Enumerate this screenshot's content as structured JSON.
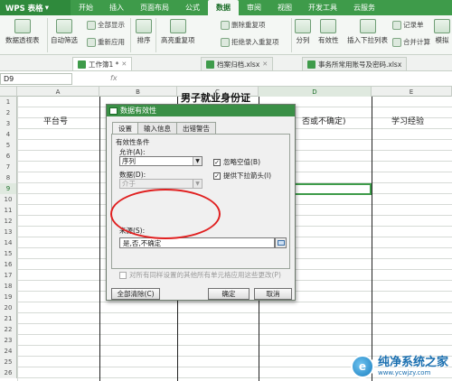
{
  "app": {
    "logo": "WPS 表格",
    "logo_arrow": "▾"
  },
  "menu": [
    "开始",
    "插入",
    "页面布局",
    "公式",
    "数据",
    "审阅",
    "视图",
    "开发工具",
    "云服务"
  ],
  "ribbon": {
    "pivot": "数据透视表",
    "autofilter": "自动筛选",
    "show_all": "全部显示",
    "reapply": "重新应用",
    "sort": "排序",
    "highlight_dup": "高亮重复项",
    "delete_dup": "删除重复项",
    "reject_dup": "拒绝录入重复项",
    "split": "分列",
    "validity": "有效性",
    "insert_dropdown": "插入下拉列表",
    "consolidate": "合并计算",
    "record": "记录单",
    "simulate": "模拟"
  },
  "doctabs": [
    {
      "label": "工作簿1 *",
      "active": true
    },
    {
      "label": "档案归档.xlsx",
      "active": false
    },
    {
      "label": "事务所常用账号及密码.xlsx",
      "active": false
    }
  ],
  "formula": {
    "cell": "D9",
    "fx": "fx"
  },
  "columns": [
    "A",
    "B",
    "C",
    "D",
    "E"
  ],
  "rows": [
    "1",
    "2",
    "3",
    "4",
    "5",
    "6",
    "7",
    "8",
    "9",
    "10",
    "11",
    "12",
    "13",
    "14",
    "15",
    "16",
    "17",
    "18",
    "19",
    "20",
    "21",
    "22",
    "23",
    "24",
    "25",
    "26"
  ],
  "sheet": {
    "title": "男子就业身份证",
    "headers": {
      "platform": "平台号",
      "d2": "否或不确定)",
      "study": "学习经验"
    }
  },
  "dialog": {
    "title": "数据有效性",
    "tabs": [
      "设置",
      "输入信息",
      "出错警告"
    ],
    "criteria_label": "有效性条件",
    "allow_label": "允许(A):",
    "allow_value": "序列",
    "data_label": "数据(D):",
    "data_value": "介于",
    "ignore_blank": "忽略空值(B)",
    "dropdown": "提供下拉箭头(I)",
    "source_label": "来源(S):",
    "source_value": "是,否,不确定",
    "apply_all": "对所有同样设置的其他所有单元格应用这些更改(P)",
    "clear_all": "全部清除(C)",
    "ok": "确定",
    "cancel": "取消"
  },
  "watermark": {
    "name": "纯净系统之家",
    "url": "www.ycwjzy.com"
  },
  "colors": {
    "brand": "#3e9b4a",
    "highlight": "#e02020"
  }
}
